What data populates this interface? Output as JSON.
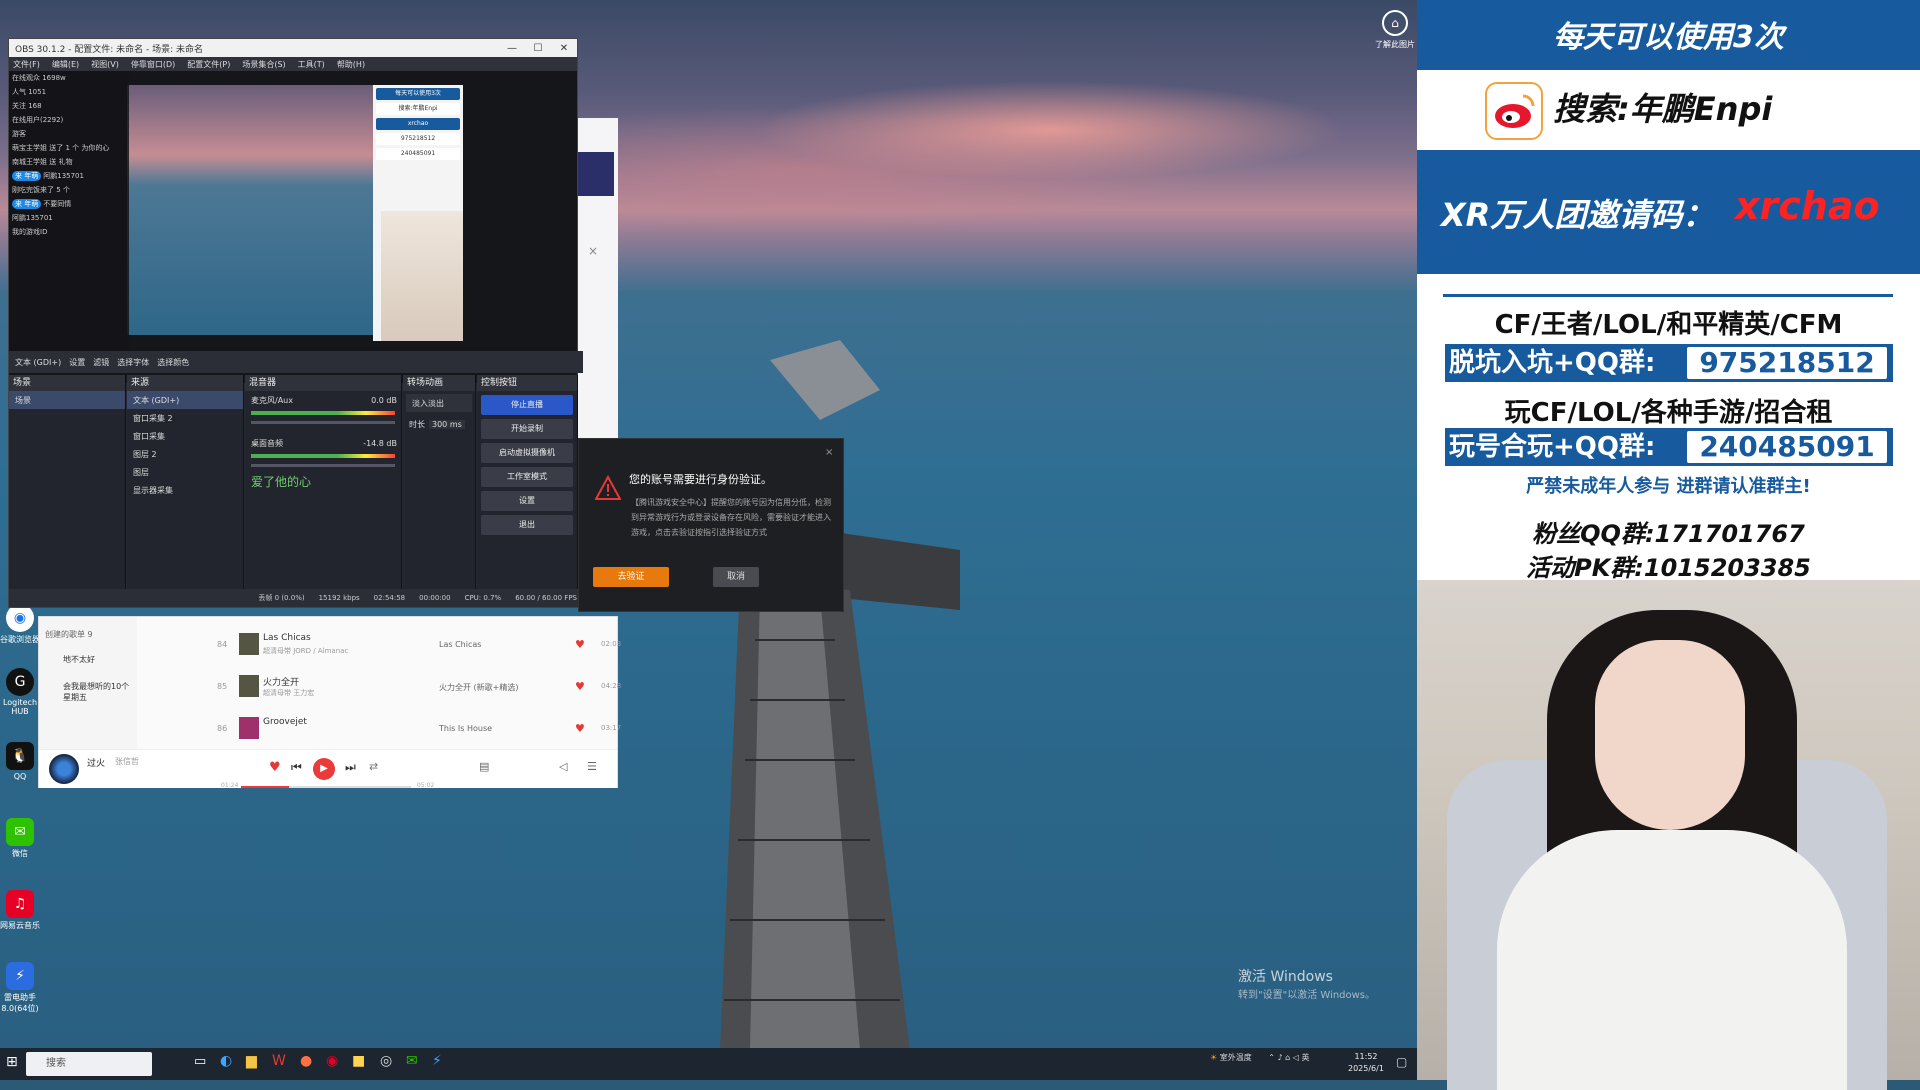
{
  "desktop": {
    "watermark_title": "激活 Windows",
    "watermark_sub": "转到\"设置\"以激活 Windows。",
    "helper_label": "了解此图片",
    "icons": [
      {
        "label": "谷歌浏览器",
        "icon": "chrome-icon"
      },
      {
        "label": "Logitech HUB",
        "icon": "logitech-icon"
      },
      {
        "label": "QQ",
        "icon": "qq-icon"
      },
      {
        "label": "微信",
        "icon": "wechat-icon"
      },
      {
        "label": "网易云音乐",
        "icon": "netease-music-icon"
      },
      {
        "label": "雷电助手 8.0(64位)",
        "icon": "assistant-icon"
      }
    ]
  },
  "obs": {
    "title": "OBS 30.1.2 - 配置文件: 未命名 - 场景: 未命名",
    "menu": [
      "文件(F)",
      "编辑(E)",
      "视图(V)",
      "停靠窗口(D)",
      "配置文件(P)",
      "场景集合(S)",
      "工具(T)",
      "帮助(H)"
    ],
    "chat": [
      "在线观众 1698w",
      "人气 1051",
      "关注 168",
      "在线用户(2292)",
      "游客",
      "萌宝主学姐 送了 1 个 为你的心",
      "南城王学姐 送 礼物",
      "刚吃完饭来了 5 个",
      "阿鹏135701",
      "不要同情",
      "阿鹏135701",
      "我的游戏ID"
    ],
    "chat_tags": [
      "来 年萌"
    ],
    "source_bar": {
      "current": "文本 (GDI+)",
      "buttons": [
        "设置",
        "滤镜",
        "选择字体",
        "选择颜色"
      ]
    },
    "docks": {
      "scenes": {
        "title": "场景",
        "items": [
          "场景"
        ]
      },
      "sources": {
        "title": "来源",
        "items": [
          "文本 (GDI+)",
          "窗口采集 2",
          "窗口采集",
          "图层 2",
          "图层",
          "显示器采集"
        ]
      },
      "mixer": {
        "title": "混音器",
        "channels": [
          {
            "name": "麦克风/Aux",
            "db": "0.0 dB"
          },
          {
            "name": "桌面音频",
            "db": "-14.8 dB"
          }
        ]
      },
      "transitions": {
        "title": "转场动画",
        "type": "淡入淡出",
        "duration_label": "时长",
        "duration": "300 ms"
      },
      "controls": {
        "title": "控制按钮",
        "buttons": [
          "停止直播",
          "开始录制",
          "启动虚拟摄像机",
          "工作室模式",
          "设置",
          "退出"
        ]
      }
    },
    "status": [
      "丢帧 0 (0.0%)",
      "15192 kbps",
      "02:54:58",
      "00:00:00",
      "CPU: 0.7%",
      "60.00 / 60.00 FPS"
    ],
    "overlay_text": "爱了他的心"
  },
  "dialog": {
    "title": "您的账号需要进行身份验证。",
    "body": "【腾讯游戏安全中心】提醒您的账号因为信用分低，检测到异常游戏行为或登录设备存在风险，需要验证才能进入游戏，点击去验证按指引选择验证方式",
    "ok": "去验证",
    "cancel": "取消",
    "close": "×"
  },
  "music": {
    "sidebar": [
      "创建的歌单 9",
      "地不太好",
      "会我最想听的10个星期五"
    ],
    "songs": [
      {
        "num": "84",
        "name": "Las Chicas",
        "tags": "超清母带 JORD / Almanac",
        "album": "Las Chicas",
        "duration": "02:03"
      },
      {
        "num": "85",
        "name": "火力全开",
        "tags": "超清母带 王力宏",
        "album": "火力全开 (新歌+精选)",
        "duration": "04:28"
      },
      {
        "num": "86",
        "name": "Groovejet",
        "tags": "",
        "album": "This Is House",
        "duration": "03:17"
      }
    ],
    "now_playing": {
      "title": "过火",
      "artist": "张信哲",
      "elapsed": "01:24",
      "total": "05:02",
      "progress": 0.28
    }
  },
  "taskbar": {
    "search_placeholder": "搜索",
    "tray_text": "室外温度",
    "lang": "英",
    "time": "11:52",
    "date": "2025/6/1"
  },
  "right_panel": {
    "top": "每天可以使用3次",
    "weibo": "搜索:年鹏Enpi",
    "xr_label": "XR万人团邀请码：",
    "xr_code": "xrchao",
    "games": "CF/王者/LOL/和平精英/CFM",
    "group1_label": "脱坑入坑+QQ群:",
    "group1_num": "975218512",
    "games2": "玩CF/LOL/各种手游/招合租",
    "group2_label": "玩号合玩+QQ群:",
    "group2_num": "240485091",
    "notice": "严禁未成年人参与 进群请认准群主!",
    "fans": "粉丝QQ群:171701767",
    "pk": "活动PK群:1015203385"
  },
  "colors": {
    "panel_blue": "#175b9e",
    "accent_red": "#ff2222",
    "obs_accent": "#e8790d"
  }
}
